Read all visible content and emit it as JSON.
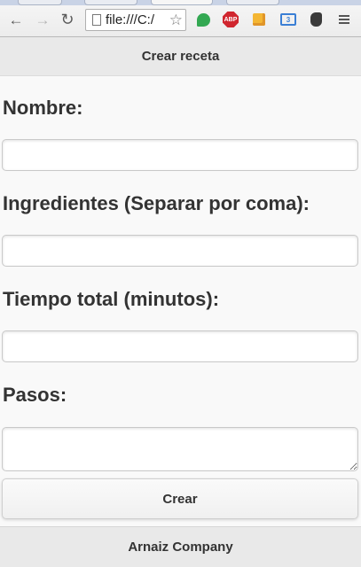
{
  "browser": {
    "address": "file:///C:/",
    "icons": [
      "back-icon",
      "forward-icon",
      "reload-icon",
      "page-icon",
      "star-icon",
      "green-extension-icon",
      "adblock-plus-icon",
      "package-extension-icon",
      "cast-extension-icon",
      "evernote-icon",
      "chrome-menu-icon"
    ],
    "abp_text": "ABP",
    "cast_text": "3"
  },
  "header": {
    "title": "Crear receta"
  },
  "form": {
    "nombre": {
      "label": "Nombre:",
      "value": ""
    },
    "ingredientes": {
      "label": "Ingredientes (Separar por coma):",
      "value": ""
    },
    "tiempo": {
      "label": "Tiempo total (minutos):",
      "value": ""
    },
    "pasos": {
      "label": "Pasos:",
      "value": ""
    },
    "submit_label": "Crear"
  },
  "footer": {
    "text": "Arnaiz Company"
  },
  "colors": {
    "header_bg": "#e9e9e9",
    "page_bg": "#f9f9f9",
    "text": "#333333"
  }
}
